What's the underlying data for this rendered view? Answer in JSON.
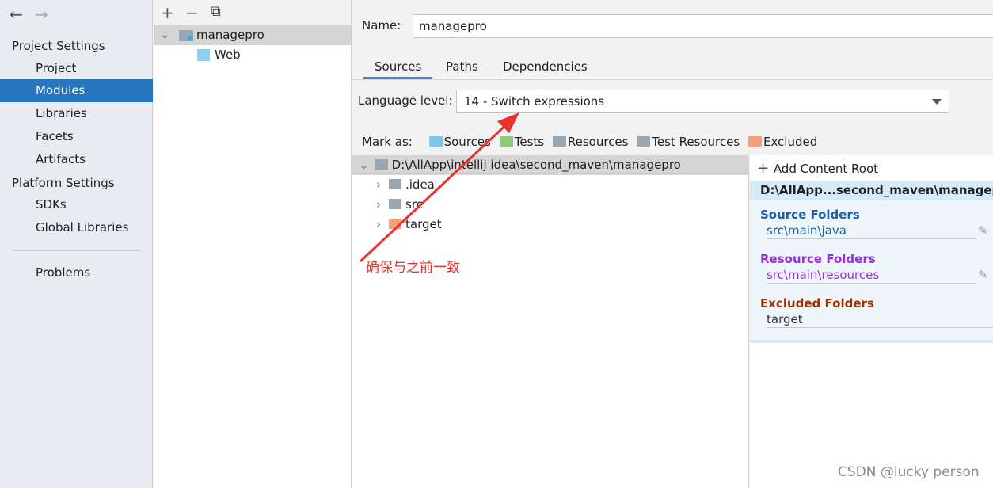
{
  "sidebar": {
    "back": "←",
    "forward": "→",
    "project_settings": "Project Settings",
    "items": [
      "Project",
      "Modules",
      "Libraries",
      "Facets",
      "Artifacts"
    ],
    "platform_settings": "Platform Settings",
    "platform_items": [
      "SDKs",
      "Global Libraries"
    ],
    "problems": "Problems"
  },
  "modules": {
    "toolbar": {
      "add": "+",
      "remove": "−",
      "copy": "⧉"
    },
    "module": "managepro",
    "facet": "Web"
  },
  "main": {
    "name_label": "Name:",
    "name_value": "managepro",
    "tabs": [
      "Sources",
      "Paths",
      "Dependencies"
    ],
    "language_label": "Language level:",
    "language_value": "14 - Switch expressions",
    "mark_as": "Mark as:",
    "marks": [
      {
        "label": "Sources",
        "color": "#7fc7e8"
      },
      {
        "label": "Tests",
        "color": "#8fca7a"
      },
      {
        "label": "Resources",
        "color": "#9aa7b0"
      },
      {
        "label": "Test Resources",
        "color": "#9aa7b0"
      },
      {
        "label": "Excluded",
        "color": "#f2a07b"
      }
    ],
    "tree": {
      "root": "D:\\AllApp\\intellij idea\\second_maven\\managepro",
      "children": [
        ".idea",
        "src",
        "target"
      ]
    },
    "content_root": {
      "add": "Add Content Root",
      "path": "D:\\AllApp...second_maven\\managepro",
      "source_label": "Source Folders",
      "source_value": "src\\main\\java",
      "resource_label": "Resource Folders",
      "resource_value": "src\\main\\resources",
      "excluded_label": "Excluded Folders",
      "excluded_value": "target"
    }
  },
  "annotation": "确保与之前一致",
  "watermark": "CSDN @lucky person",
  "colors": {
    "selection": "#2675bf",
    "source": "#1a5ea8",
    "resource": "#9b30d9",
    "excluded": "#a03000",
    "annotation": "#e8322f"
  }
}
